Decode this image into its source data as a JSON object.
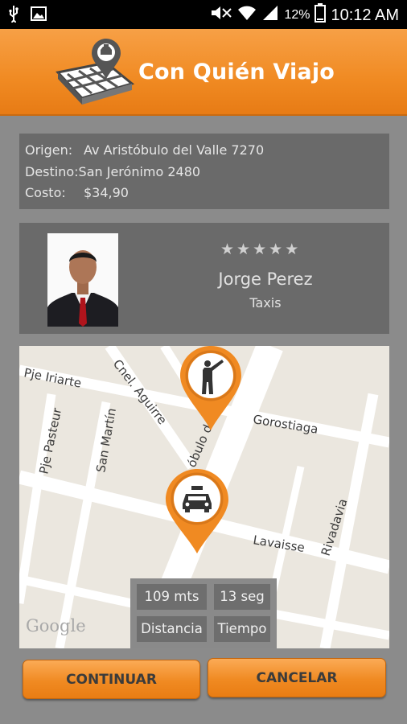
{
  "status_bar": {
    "battery": "12%",
    "time": "10:12 AM"
  },
  "header": {
    "title": "Con Quién Viajo"
  },
  "trip": {
    "origin_label": "Origen:",
    "origin_value": "Av Aristóbulo del Valle 7270",
    "destination_label": "Destino:",
    "destination_value": "San Jerónimo 2480",
    "cost_label": "Costo:",
    "cost_value": "$34,90"
  },
  "driver": {
    "rating_stars": 5,
    "name": "Jorge Perez",
    "company": "Taxis"
  },
  "map": {
    "streets": [
      "Pje Iriarte",
      "Cnel. Aguirre",
      "Pje Pasteur",
      "San Martín",
      "Gorostiaga",
      "óbulo del Valle",
      "Lavaisse",
      "Rivadavia"
    ],
    "attribution": "Google",
    "distance_value": "109 mts",
    "time_value": "13 seg",
    "distance_label": "Distancia",
    "time_label": "Tiempo"
  },
  "buttons": {
    "continue": "CONTINUAR",
    "cancel": "CANCELAR"
  },
  "colors": {
    "accent": "#f08a22",
    "panel": "#6a6a6a",
    "background": "#8b8b8b"
  }
}
